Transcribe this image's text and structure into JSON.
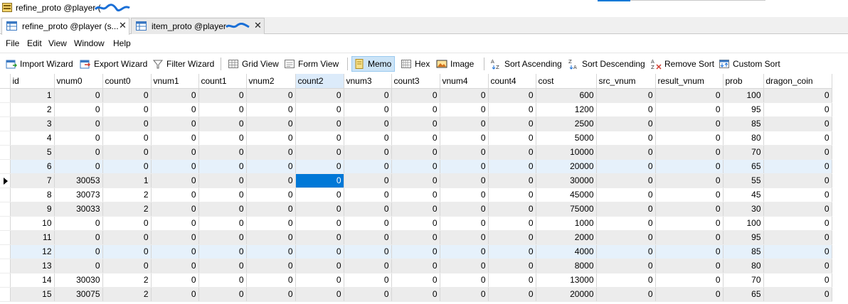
{
  "window": {
    "title": "refine_proto @player ("
  },
  "tabs": [
    {
      "label": "refine_proto @player (s...",
      "close": "✕",
      "active": true
    },
    {
      "label": "item_proto @player",
      "close": "✕",
      "active": false
    }
  ],
  "menu": [
    "File",
    "Edit",
    "View",
    "Window",
    "Help"
  ],
  "toolbar": {
    "import_wizard": "Import Wizard",
    "export_wizard": "Export Wizard",
    "filter_wizard": "Filter Wizard",
    "grid_view": "Grid View",
    "form_view": "Form View",
    "memo": "Memo",
    "hex": "Hex",
    "image": "Image",
    "sort_ascending": "Sort Ascending",
    "sort_descending": "Sort Descending",
    "remove_sort": "Remove Sort",
    "custom_sort": "Custom Sort"
  },
  "grid": {
    "columns": [
      "id",
      "vnum0",
      "count0",
      "vnum1",
      "count1",
      "vnum2",
      "count2",
      "vnum3",
      "count3",
      "vnum4",
      "count4",
      "cost",
      "src_vnum",
      "result_vnum",
      "prob",
      "dragon_coin"
    ],
    "selected_column": "count2",
    "current_row": 7,
    "rows": [
      [
        "1",
        "0",
        "0",
        "0",
        "0",
        "0",
        "0",
        "0",
        "0",
        "0",
        "0",
        "600",
        "0",
        "0",
        "100",
        "0"
      ],
      [
        "2",
        "0",
        "0",
        "0",
        "0",
        "0",
        "0",
        "0",
        "0",
        "0",
        "0",
        "1200",
        "0",
        "0",
        "95",
        "0"
      ],
      [
        "3",
        "0",
        "0",
        "0",
        "0",
        "0",
        "0",
        "0",
        "0",
        "0",
        "0",
        "2500",
        "0",
        "0",
        "85",
        "0"
      ],
      [
        "4",
        "0",
        "0",
        "0",
        "0",
        "0",
        "0",
        "0",
        "0",
        "0",
        "0",
        "5000",
        "0",
        "0",
        "80",
        "0"
      ],
      [
        "5",
        "0",
        "0",
        "0",
        "0",
        "0",
        "0",
        "0",
        "0",
        "0",
        "0",
        "10000",
        "0",
        "0",
        "70",
        "0"
      ],
      [
        "6",
        "0",
        "0",
        "0",
        "0",
        "0",
        "0",
        "0",
        "0",
        "0",
        "0",
        "20000",
        "0",
        "0",
        "65",
        "0"
      ],
      [
        "7",
        "30053",
        "1",
        "0",
        "0",
        "0",
        "0",
        "0",
        "0",
        "0",
        "0",
        "30000",
        "0",
        "0",
        "55",
        "0"
      ],
      [
        "8",
        "30073",
        "2",
        "0",
        "0",
        "0",
        "0",
        "0",
        "0",
        "0",
        "0",
        "45000",
        "0",
        "0",
        "45",
        "0"
      ],
      [
        "9",
        "30033",
        "2",
        "0",
        "0",
        "0",
        "0",
        "0",
        "0",
        "0",
        "0",
        "75000",
        "0",
        "0",
        "30",
        "0"
      ],
      [
        "10",
        "0",
        "0",
        "0",
        "0",
        "0",
        "0",
        "0",
        "0",
        "0",
        "0",
        "1000",
        "0",
        "0",
        "100",
        "0"
      ],
      [
        "11",
        "0",
        "0",
        "0",
        "0",
        "0",
        "0",
        "0",
        "0",
        "0",
        "0",
        "2000",
        "0",
        "0",
        "95",
        "0"
      ],
      [
        "12",
        "0",
        "0",
        "0",
        "0",
        "0",
        "0",
        "0",
        "0",
        "0",
        "0",
        "4000",
        "0",
        "0",
        "85",
        "0"
      ],
      [
        "13",
        "0",
        "0",
        "0",
        "0",
        "0",
        "0",
        "0",
        "0",
        "0",
        "0",
        "8000",
        "0",
        "0",
        "80",
        "0"
      ],
      [
        "14",
        "30030",
        "2",
        "0",
        "0",
        "0",
        "0",
        "0",
        "0",
        "0",
        "0",
        "13000",
        "0",
        "0",
        "70",
        "0"
      ],
      [
        "15",
        "30075",
        "2",
        "0",
        "0",
        "0",
        "0",
        "0",
        "0",
        "0",
        "0",
        "20000",
        "0",
        "0",
        "65",
        "0"
      ]
    ]
  },
  "colors": {
    "selection": "#0078d7",
    "header_selected": "#dcebfa",
    "row_alt": "#ececec",
    "row_tint": "#e6f1fb",
    "scribble": "#1a6fd6"
  }
}
